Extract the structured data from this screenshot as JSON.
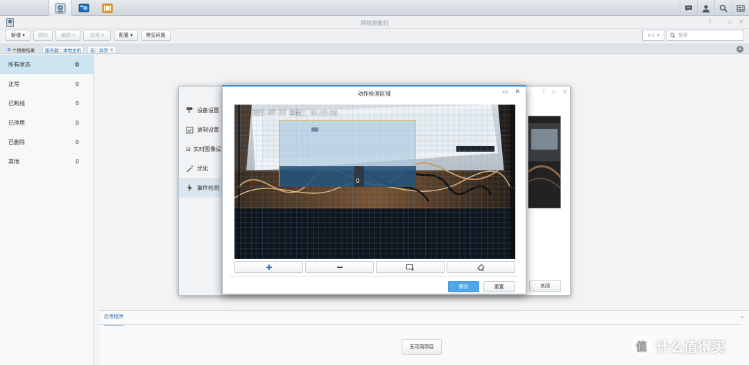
{
  "window": {
    "title": "网络摄像机"
  },
  "toolbar": {
    "new_label": "新增",
    "delete_label": "删除",
    "edit_label": "编辑",
    "enable_label": "启用",
    "config_label": "配置",
    "faq_label": "常见问题",
    "search_placeholder": "搜索"
  },
  "filter": {
    "result_count": "0",
    "result_label": "个搜索结果",
    "server_chip": "服务器：本地主机",
    "volume_chip": "卷：异常"
  },
  "sidebar": {
    "items": [
      {
        "label": "所有状态",
        "count": "0"
      },
      {
        "label": "正常",
        "count": "0"
      },
      {
        "label": "已断线",
        "count": "0"
      },
      {
        "label": "已停用",
        "count": "0"
      },
      {
        "label": "已删除",
        "count": "0"
      },
      {
        "label": "其他",
        "count": "0"
      }
    ]
  },
  "bottom_panel": {
    "tab_label": "应用程序",
    "button_label": "无可用项目"
  },
  "settings_dialog": {
    "nav": [
      {
        "label": "设备设置",
        "icon": "camera-settings-icon"
      },
      {
        "label": "录制设置",
        "icon": "record-settings-icon"
      },
      {
        "label": "实时图像设",
        "icon": "live-view-icon"
      },
      {
        "label": "优化",
        "icon": "magic-wand-icon"
      },
      {
        "label": "事件检测",
        "icon": "lightning-icon"
      }
    ],
    "close_label": "关闭"
  },
  "motion_dialog": {
    "title": "动作检测区域",
    "timestamp": "2021-07-27 星期二 15:13:56",
    "tools": [
      "plus-icon",
      "minus-icon",
      "add-region-icon",
      "eraser-icon"
    ],
    "save_label": "保存",
    "reset_label": "重置",
    "accent_color": "#4fa8e8",
    "region_color": "#e3b21c"
  },
  "watermark": {
    "text": "什么值得买"
  }
}
